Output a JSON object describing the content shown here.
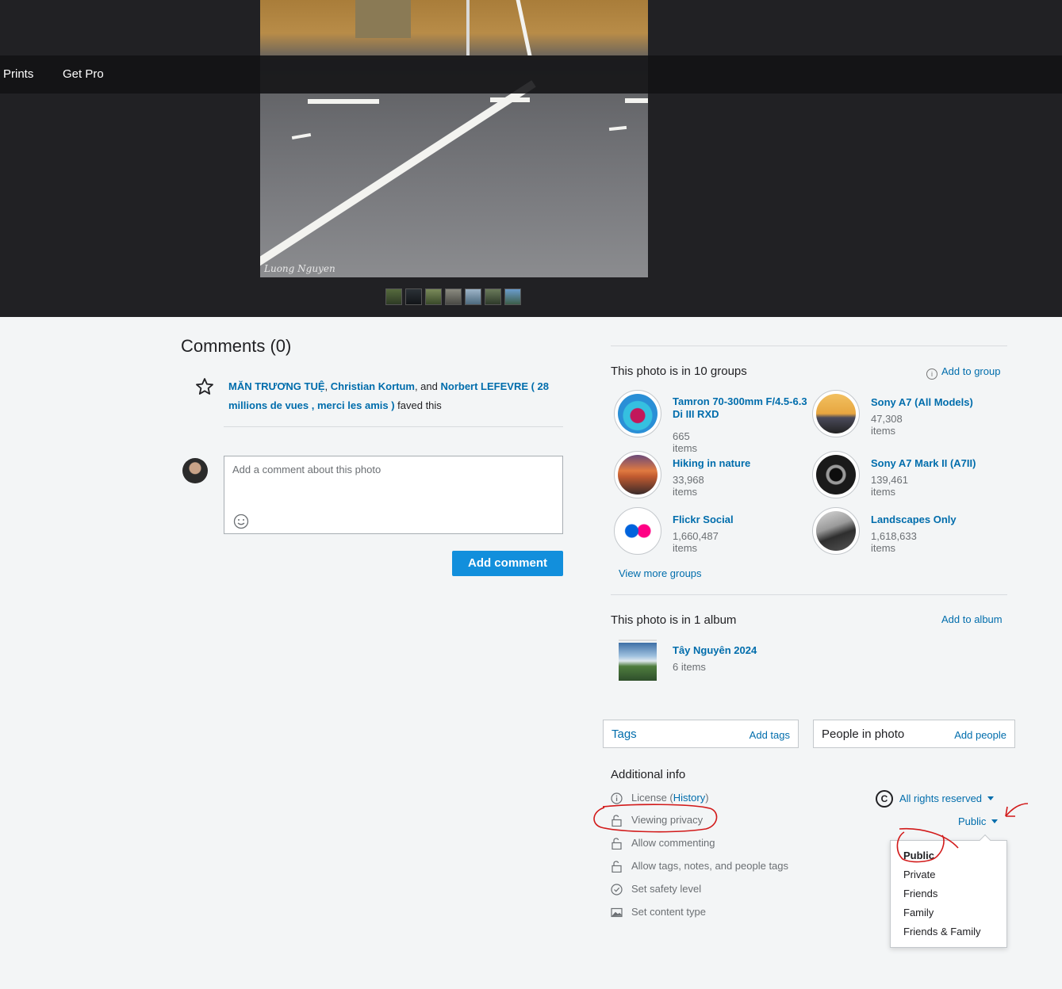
{
  "nav": {
    "prints": "Prints",
    "get_pro": "Get Pro"
  },
  "photo": {
    "watermark": "Luong Nguyen"
  },
  "comments": {
    "title": "Comments (0)",
    "fave_user_1": "MĂN TRƯƠNG TUỆ",
    "sep_1": ", ",
    "fave_user_2": "Christian Kortum",
    "sep_2": ", and ",
    "fave_user_3": "Norbert LEFEVRE ( 28 millions de vues , merci les amis )",
    "faved_suffix": " faved this",
    "placeholder": "Add a comment about this photo",
    "add_button": "Add comment"
  },
  "groups": {
    "title": "This photo is in 10 groups",
    "add_link": "Add to group",
    "items": [
      {
        "name": "Tamron 70-300mm F/4.5-6.3 Di III RXD",
        "count": "665 items"
      },
      {
        "name": "Sony A7 (All Models)",
        "count": "47,308 items"
      },
      {
        "name": "Hiking in nature",
        "count": "33,968 items"
      },
      {
        "name": "Sony A7 Mark II (A7II)",
        "count": "139,461 items"
      },
      {
        "name": "Flickr Social",
        "count": "1,660,487 items"
      },
      {
        "name": "Landscapes Only",
        "count": "1,618,633 items"
      }
    ],
    "view_more": "View more groups"
  },
  "album": {
    "title": "This photo is in 1 album",
    "add_link": "Add to album",
    "name": "Tây Nguyên 2024",
    "count": "6 items"
  },
  "tags": {
    "label": "Tags",
    "action": "Add tags"
  },
  "people": {
    "label": "People in photo",
    "action": "Add people"
  },
  "additional": {
    "title": "Additional info",
    "license_prefix": "License (",
    "license_history": "History",
    "license_suffix": ")",
    "license_value": "All rights reserved",
    "viewing_privacy": "Viewing privacy",
    "privacy_value": "Public",
    "allow_commenting": "Allow commenting",
    "allow_tags": "Allow tags, notes, and people tags",
    "safety": "Set safety level",
    "content_type": "Set content type"
  },
  "privacy_menu": {
    "options": [
      "Public",
      "Private",
      "Friends",
      "Family",
      "Friends & Family"
    ]
  },
  "colors": {
    "accent": "#128fdc",
    "link": "#006dac",
    "annotation": "#d21a1a"
  }
}
